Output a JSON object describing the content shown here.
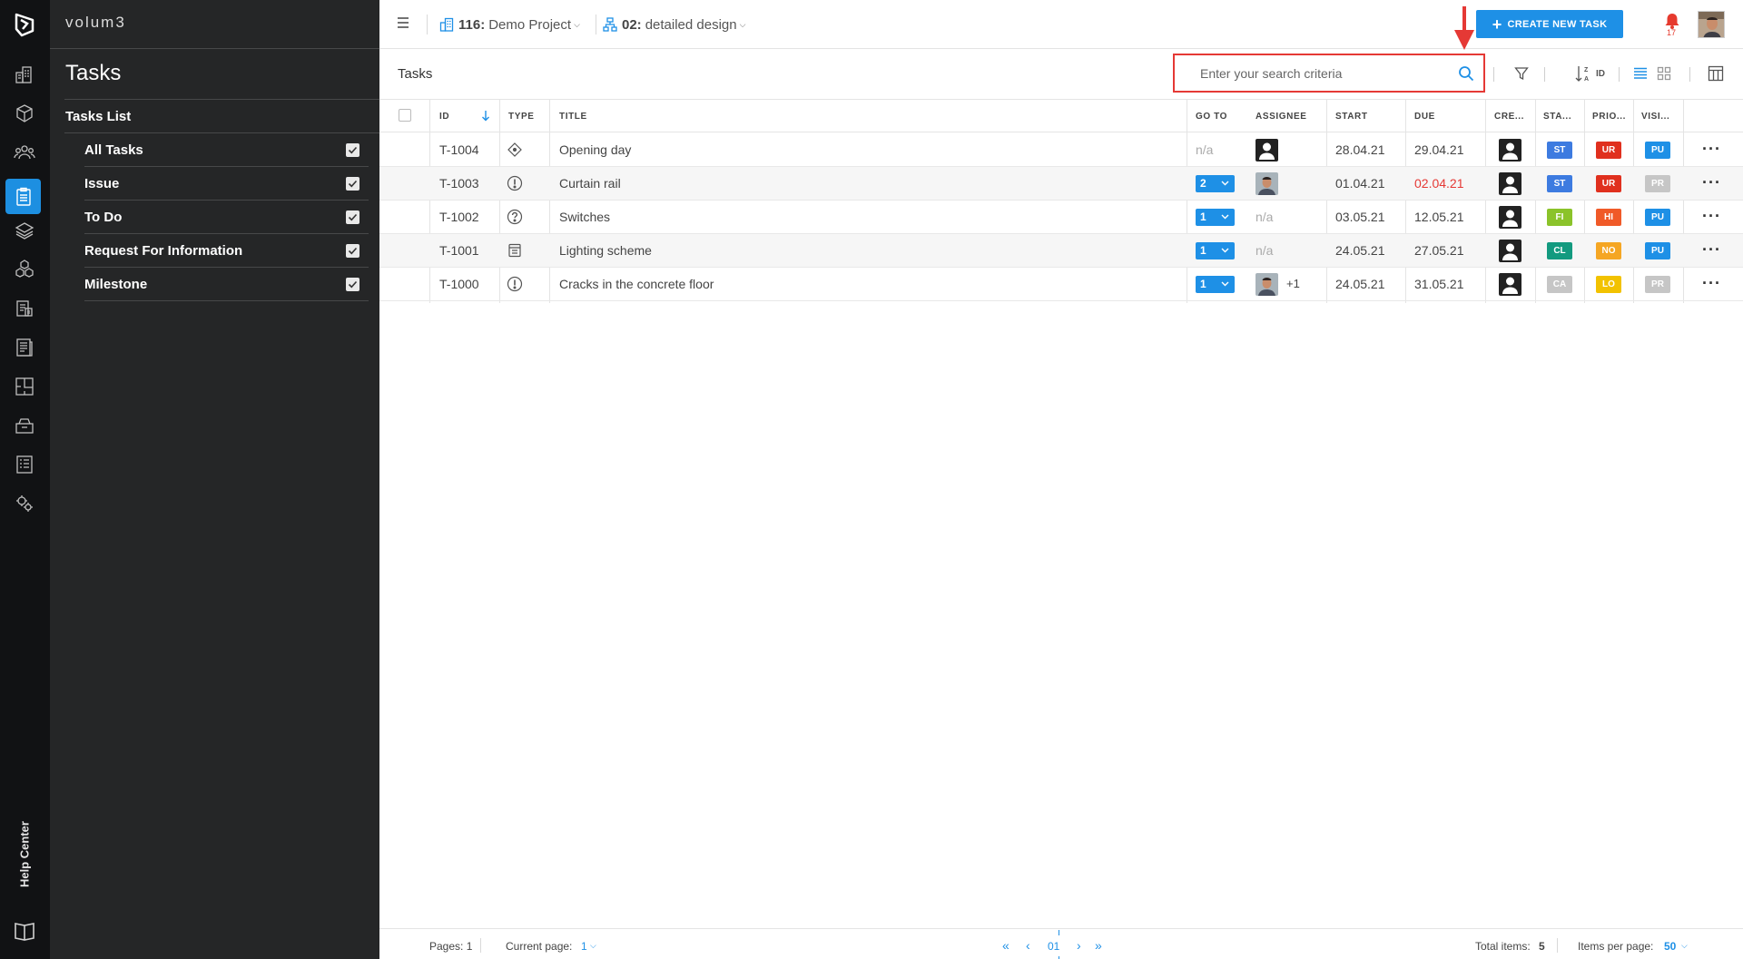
{
  "app": {
    "brand": "volum3",
    "help_center": "Help Center"
  },
  "sidebar": {
    "title": "Tasks",
    "list_heading": "Tasks List",
    "items": [
      {
        "label": "All Tasks",
        "checked": true
      },
      {
        "label": "Issue",
        "checked": true
      },
      {
        "label": "To Do",
        "checked": true
      },
      {
        "label": "Request For Information",
        "checked": true
      },
      {
        "label": "Milestone",
        "checked": true
      }
    ]
  },
  "topbar": {
    "project_number": "116:",
    "project_name": "Demo Project",
    "phase_number": "02:",
    "phase_name": "detailed design",
    "create_button": "CREATE NEW TASK",
    "notifications_count": "17"
  },
  "toolbar": {
    "title": "Tasks",
    "search_placeholder": "Enter your search criteria",
    "sort_label": "ID"
  },
  "table": {
    "headers": {
      "id": "ID",
      "type": "TYPE",
      "title": "TITLE",
      "goto": "GO TO",
      "assignee": "ASSIGNEE",
      "start": "START",
      "due": "DUE",
      "creator": "CRE...",
      "status": "STA...",
      "priority": "PRIO...",
      "visibility": "VISI..."
    },
    "rows": [
      {
        "id": "T-1004",
        "type": "milestone",
        "title": "Opening day",
        "goto": "n/a",
        "assignee": "user-placeholder",
        "assignee_extra": "",
        "start": "28.04.21",
        "due": "29.04.21",
        "due_overdue": false,
        "status": "ST",
        "status_color": "#3d7be0",
        "priority": "UR",
        "priority_color": "#e0301e",
        "visibility": "PU",
        "visibility_color": "#1e90e6"
      },
      {
        "id": "T-1003",
        "type": "issue",
        "title": "Curtain rail",
        "goto": "2",
        "assignee": "photo",
        "assignee_extra": "",
        "start": "01.04.21",
        "due": "02.04.21",
        "due_overdue": true,
        "status": "ST",
        "status_color": "#3d7be0",
        "priority": "UR",
        "priority_color": "#e0301e",
        "visibility": "PR",
        "visibility_color": "#c6c6c6"
      },
      {
        "id": "T-1002",
        "type": "rfi",
        "title": "Switches",
        "goto": "1",
        "assignee": "n/a",
        "assignee_extra": "",
        "start": "03.05.21",
        "due": "12.05.21",
        "due_overdue": false,
        "status": "FI",
        "status_color": "#8bc32a",
        "priority": "HI",
        "priority_color": "#f05a28",
        "visibility": "PU",
        "visibility_color": "#1e90e6"
      },
      {
        "id": "T-1001",
        "type": "todo",
        "title": "Lighting scheme",
        "goto": "1",
        "assignee": "n/a",
        "assignee_extra": "",
        "start": "24.05.21",
        "due": "27.05.21",
        "due_overdue": false,
        "status": "CL",
        "status_color": "#139a7f",
        "priority": "NO",
        "priority_color": "#f5a623",
        "visibility": "PU",
        "visibility_color": "#1e90e6"
      },
      {
        "id": "T-1000",
        "type": "issue",
        "title": "Cracks in the concrete floor",
        "goto": "1",
        "assignee": "photo",
        "assignee_extra": "+1",
        "start": "24.05.21",
        "due": "31.05.21",
        "due_overdue": false,
        "status": "CA",
        "status_color": "#c6c6c6",
        "priority": "LO",
        "priority_color": "#f2c200",
        "visibility": "PR",
        "visibility_color": "#c6c6c6"
      }
    ]
  },
  "footer": {
    "pages_label": "Pages: 1",
    "current_page_label": "Current page:",
    "current_page_value": "1",
    "pager_current": "01",
    "total_label": "Total items:",
    "total_value": "5",
    "per_page_label": "Items per page:",
    "per_page_value": "50"
  },
  "colors": {
    "accent": "#1e90e6",
    "rail_bg": "#111214",
    "sidebar_bg": "#252627",
    "highlight": "#e53935"
  }
}
